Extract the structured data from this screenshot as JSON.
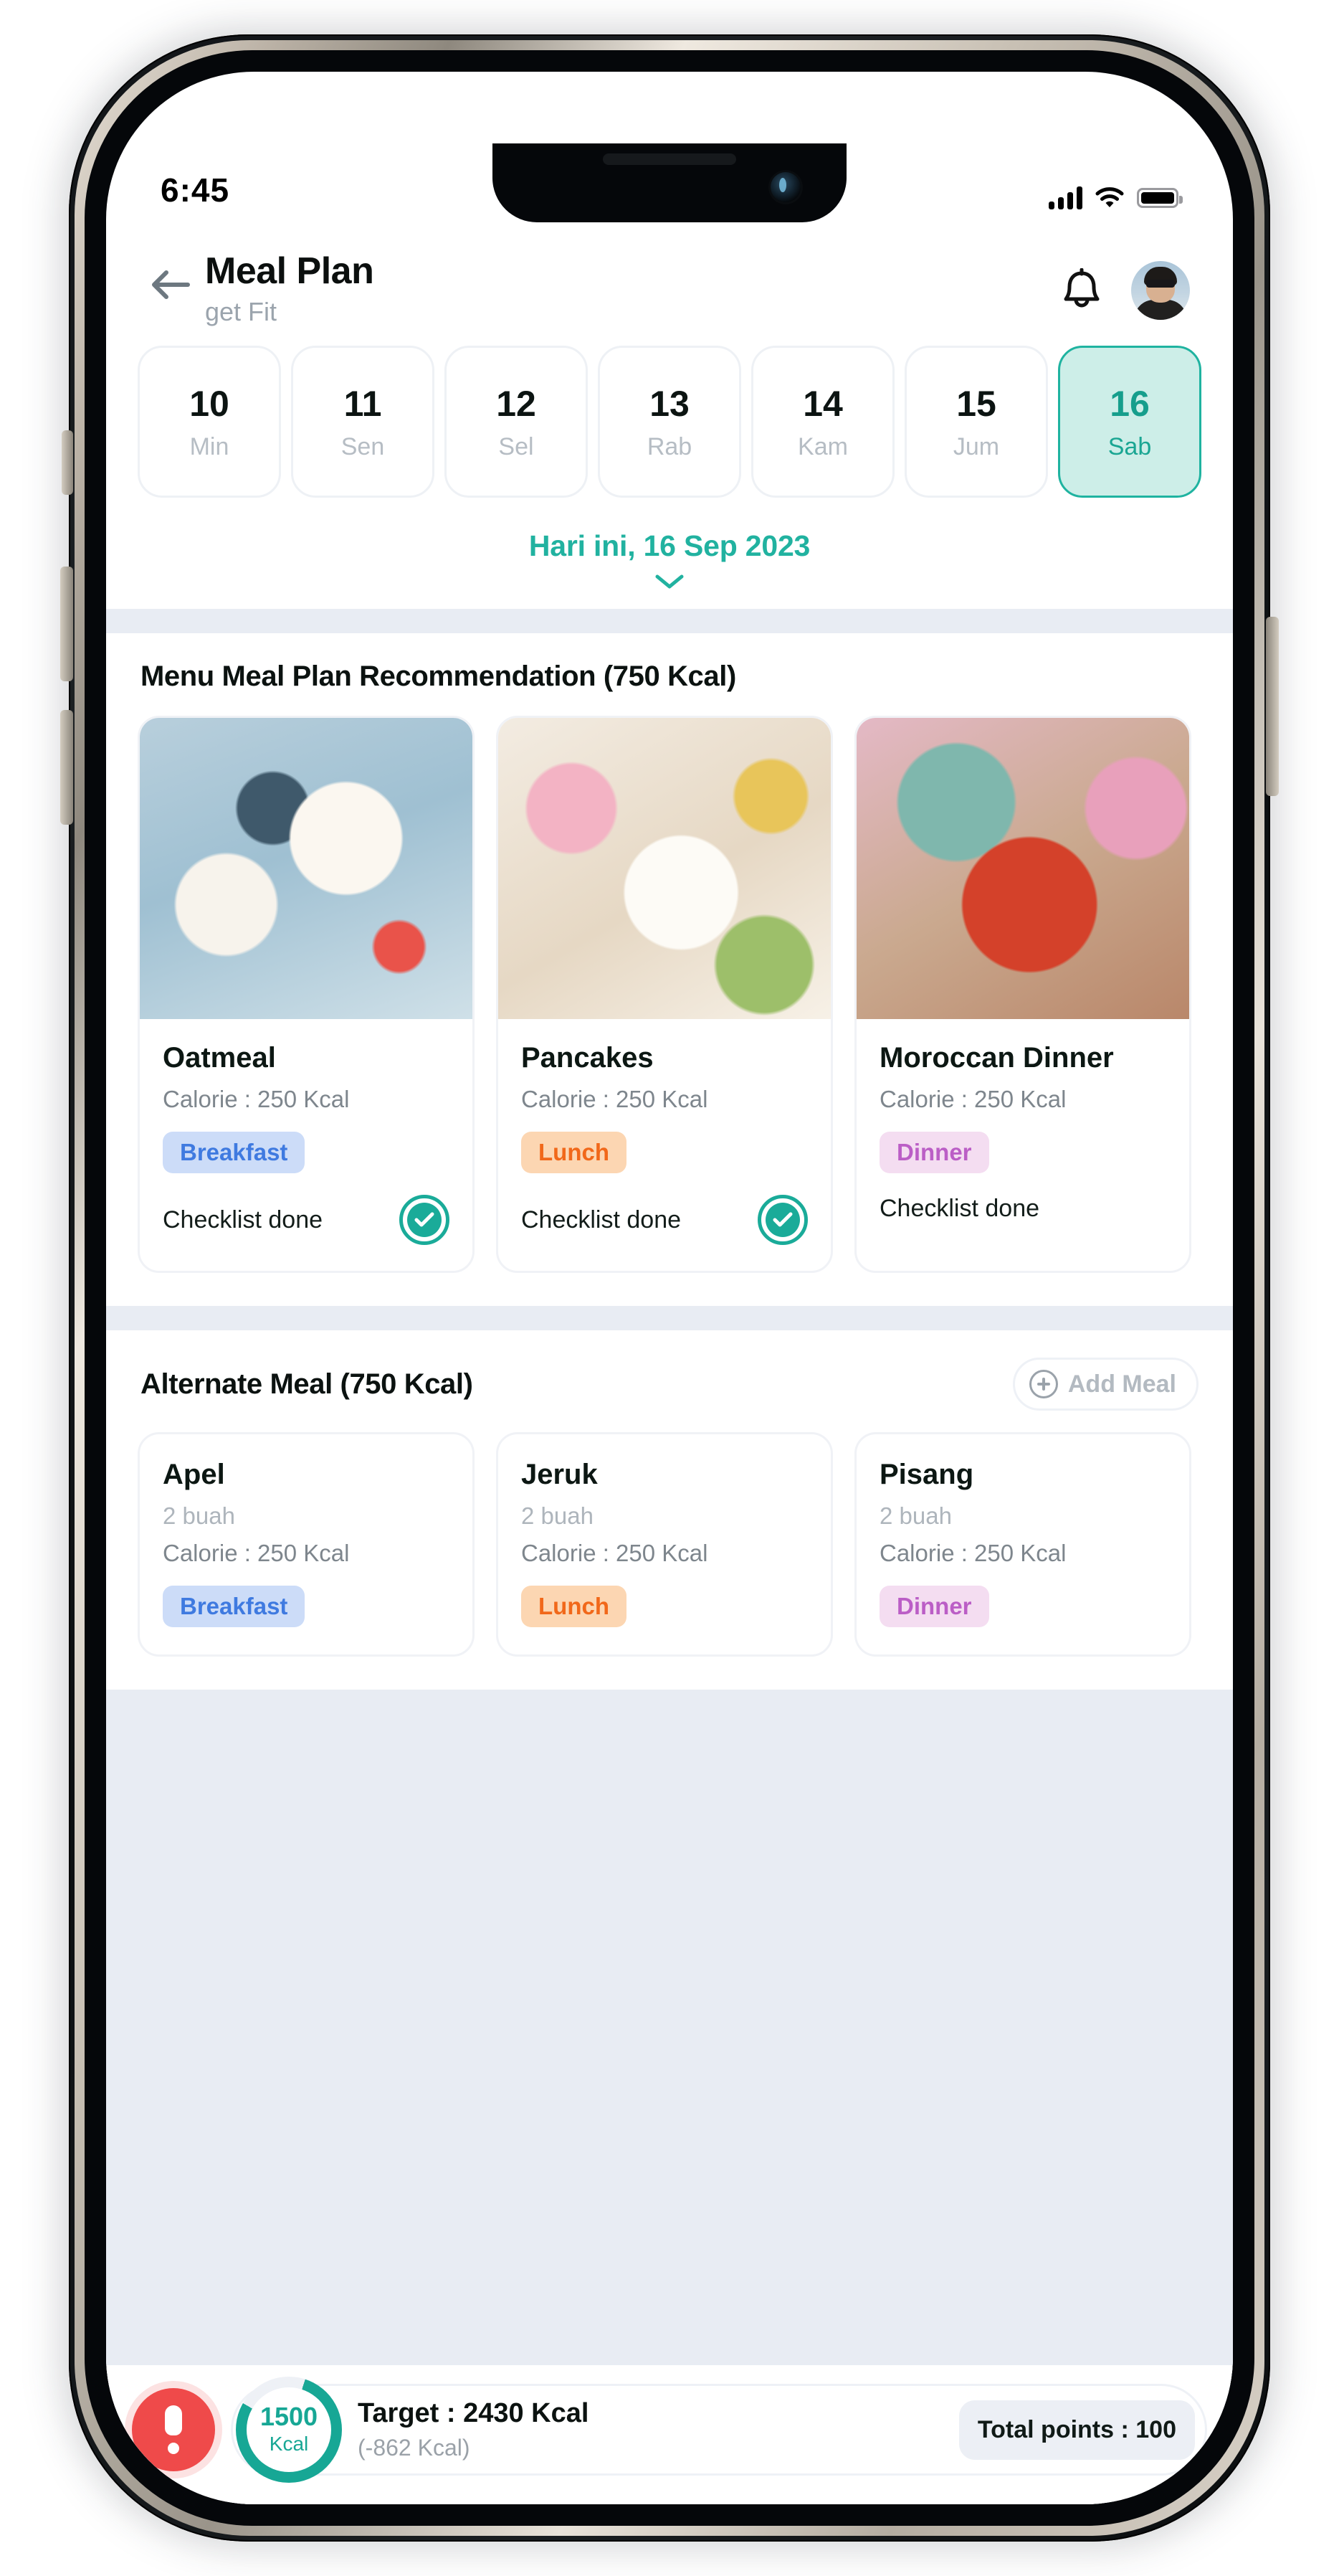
{
  "status_bar": {
    "time": "6:45",
    "icons": [
      "cellular-signal-icon",
      "wifi-icon",
      "battery-icon"
    ]
  },
  "header": {
    "back_icon": "arrow-left-icon",
    "title": "Meal Plan",
    "subtitle": "get Fit",
    "bell_icon": "bell-icon",
    "avatar": "user-avatar"
  },
  "date_strip": {
    "days": [
      {
        "num": "10",
        "dow": "Min",
        "selected": false
      },
      {
        "num": "11",
        "dow": "Sen",
        "selected": false
      },
      {
        "num": "12",
        "dow": "Sel",
        "selected": false
      },
      {
        "num": "13",
        "dow": "Rab",
        "selected": false
      },
      {
        "num": "14",
        "dow": "Kam",
        "selected": false
      },
      {
        "num": "15",
        "dow": "Jum",
        "selected": false
      },
      {
        "num": "16",
        "dow": "Sab",
        "selected": true
      }
    ],
    "today_label": "Hari ini, 16 Sep 2023",
    "expand_icon": "chevron-down-icon"
  },
  "recommendation": {
    "title": "Menu Meal Plan Recommendation (750 Kcal)",
    "cards": [
      {
        "name": "Oatmeal",
        "calorie": "Calorie : 250 Kcal",
        "tag": "Breakfast",
        "tag_type": "breakfast",
        "checklist": "Checklist done",
        "checked": true,
        "image": "oatmeal-bowl-photo"
      },
      {
        "name": "Pancakes",
        "calorie": "Calorie : 250 Kcal",
        "tag": "Lunch",
        "tag_type": "lunch",
        "checklist": "Checklist done",
        "checked": true,
        "image": "pancakes-berries-photo"
      },
      {
        "name": "Moroccan Dinner",
        "calorie": "Calorie : 250 Kcal",
        "tag": "Dinner",
        "tag_type": "dinner",
        "checklist": "Checklist done",
        "checked": false,
        "image": "moroccan-tagine-photo"
      }
    ]
  },
  "alternate": {
    "title": "Alternate Meal (750 Kcal)",
    "add_button": {
      "label": "Add Meal",
      "icon": "plus-circle-icon"
    },
    "cards": [
      {
        "name": "Apel",
        "qty": "2 buah",
        "calorie": "Calorie : 250 Kcal",
        "tag": "Breakfast",
        "tag_type": "breakfast"
      },
      {
        "name": "Jeruk",
        "qty": "2 buah",
        "calorie": "Calorie : 250 Kcal",
        "tag": "Lunch",
        "tag_type": "lunch"
      },
      {
        "name": "Pisang",
        "qty": "2 buah",
        "calorie": "Calorie : 250 Kcal",
        "tag": "Dinner",
        "tag_type": "dinner"
      }
    ]
  },
  "bottom_bar": {
    "alert_icon": "alert-exclamation-icon",
    "ring_value": "1500",
    "ring_unit": "Kcal",
    "ring_percent": 78,
    "target_label": "Target : 2430 Kcal",
    "target_delta": "(-862 Kcal)",
    "points_label": "Total points : 100"
  },
  "colors": {
    "teal": "#17a795",
    "teal_soft": "#cdeee8",
    "blue_tag_bg": "#ccdcf8",
    "blue_tag_fg": "#3f7ae0",
    "orange_tag_bg": "#fcd6b2",
    "orange_tag_fg": "#f1681a",
    "purple_tag_bg": "#f4ddf1",
    "purple_tag_fg": "#bb5ec6",
    "alert_red": "#ef4a4a",
    "page_bg": "#e8ecf3"
  }
}
